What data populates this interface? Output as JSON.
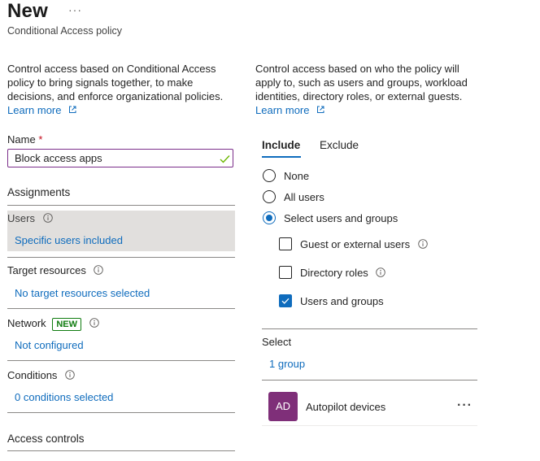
{
  "header": {
    "title": "New",
    "more_label": "···",
    "subtitle": "Conditional Access policy"
  },
  "left": {
    "intro": "Control access based on Conditional Access policy to bring signals together, to make decisions, and enforce organizational policies.",
    "learn_more": "Learn more",
    "name_label": "Name",
    "required_mark": "*",
    "name_value": "Block access apps",
    "assignments_heading": "Assignments",
    "users_label": "Users",
    "users_value": "Specific users included",
    "target_label": "Target resources",
    "target_value": "No target resources selected",
    "network_label": "Network",
    "network_badge": "NEW",
    "network_value": "Not configured",
    "conditions_label": "Conditions",
    "conditions_value": "0 conditions selected",
    "access_controls_heading": "Access controls"
  },
  "right": {
    "intro": "Control access based on who the policy will apply to, such as users and groups, workload identities, directory roles, or external guests.",
    "learn_more": "Learn more",
    "tabs": [
      {
        "label": "Include",
        "selected": true
      },
      {
        "label": "Exclude",
        "selected": false
      }
    ],
    "radios": [
      {
        "label": "None",
        "selected": false
      },
      {
        "label": "All users",
        "selected": false
      },
      {
        "label": "Select users and groups",
        "selected": true
      }
    ],
    "checkboxes": [
      {
        "label": "Guest or external users",
        "checked": false
      },
      {
        "label": "Directory roles",
        "checked": false
      },
      {
        "label": "Users and groups",
        "checked": true
      }
    ],
    "select_heading": "Select",
    "select_value": "1 group",
    "selected_item": {
      "initials": "AD",
      "name": "Autopilot devices",
      "more": "···"
    }
  },
  "colors": {
    "accent": "#0f6cbd",
    "avatar": "#7f2f79",
    "badge": "#107c10",
    "required": "#c50f1f"
  },
  "icons": [
    "more-icon",
    "external-link-icon",
    "checkmark-icon",
    "info-icon"
  ]
}
